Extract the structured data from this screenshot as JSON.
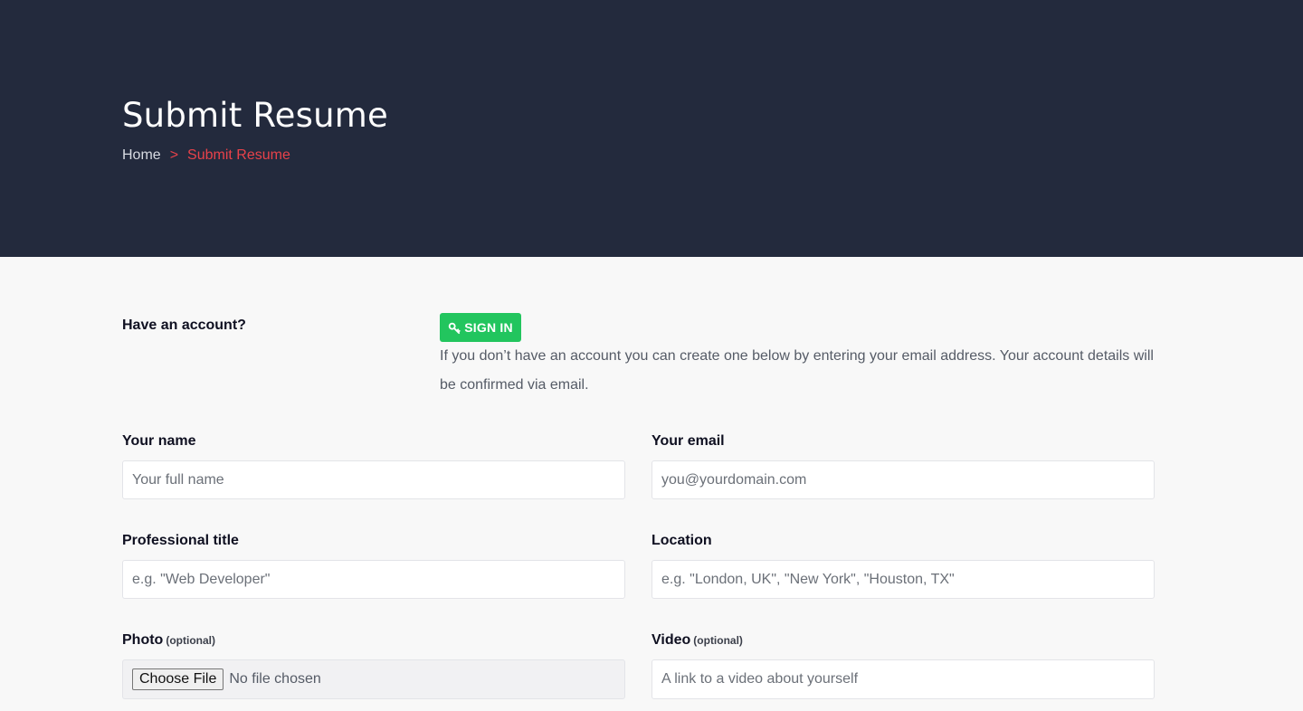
{
  "header": {
    "title": "Submit Resume",
    "breadcrumb": {
      "home": "Home",
      "separator": ">",
      "current": "Submit Resume"
    }
  },
  "account": {
    "label": "Have an account?",
    "signin_label": "SIGN IN",
    "signin_icon": "key-icon",
    "help_text": "If you don’t have an account you can create one below by entering your email address. Your account details will be confirmed via email."
  },
  "form": {
    "name": {
      "label": "Your name",
      "placeholder": "Your full name",
      "value": ""
    },
    "email": {
      "label": "Your email",
      "placeholder": "you@yourdomain.com",
      "value": ""
    },
    "title": {
      "label": "Professional title",
      "placeholder": "e.g. \"Web Developer\"",
      "value": ""
    },
    "location": {
      "label": "Location",
      "placeholder": "e.g. \"London, UK\", \"New York\", \"Houston, TX\"",
      "value": ""
    },
    "photo": {
      "label": "Photo",
      "optional": "(optional)",
      "button_label": "Choose File",
      "status": "No file chosen"
    },
    "video": {
      "label": "Video",
      "optional": "(optional)",
      "placeholder": "A link to a video about yourself",
      "value": ""
    }
  },
  "colors": {
    "hero_bg": "#232a3d",
    "accent_red": "#e8424a",
    "signin_green": "#22c55e",
    "page_bg": "#f8f8f8"
  }
}
